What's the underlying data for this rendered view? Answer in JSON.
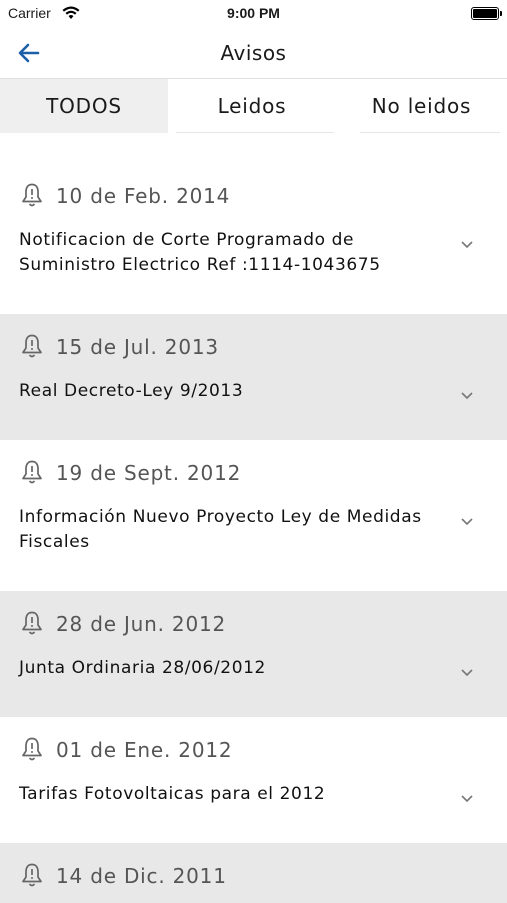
{
  "status_bar": {
    "carrier": "Carrier",
    "time": "9:00 PM"
  },
  "header": {
    "title": "Avisos"
  },
  "tabs": [
    {
      "label": "TODOS",
      "selected": true
    },
    {
      "label": "Leidos",
      "selected": false
    },
    {
      "label": "No leidos",
      "selected": false
    }
  ],
  "notices": [
    {
      "date": "10 de Feb. 2014",
      "text": "Notificacion de Corte Programado de Suministro Electrico Ref :1114-1043675",
      "icon": "bell-icon",
      "expand_icon": "chevron-down-icon"
    },
    {
      "date": "15 de Jul. 2013",
      "text": "Real Decreto-Ley 9/2013",
      "icon": "bell-icon",
      "expand_icon": "chevron-down-icon"
    },
    {
      "date": "19 de Sept. 2012",
      "text": "Información Nuevo Proyecto Ley de Medidas Fiscales",
      "icon": "bell-icon",
      "expand_icon": "chevron-down-icon"
    },
    {
      "date": "28 de Jun. 2012",
      "text": "Junta Ordinaria 28/06/2012",
      "icon": "bell-icon",
      "expand_icon": "chevron-down-icon"
    },
    {
      "date": "01 de Ene. 2012",
      "text": "Tarifas Fotovoltaicas para el 2012",
      "icon": "bell-icon",
      "expand_icon": "chevron-down-icon"
    },
    {
      "date": "14 de Dic. 2011",
      "text": "",
      "icon": "bell-icon",
      "expand_icon": "chevron-down-icon"
    }
  ],
  "colors": {
    "accent": "#1b5fa8",
    "alt_row": "#e8e8e8",
    "active_tab": "#efefef"
  }
}
